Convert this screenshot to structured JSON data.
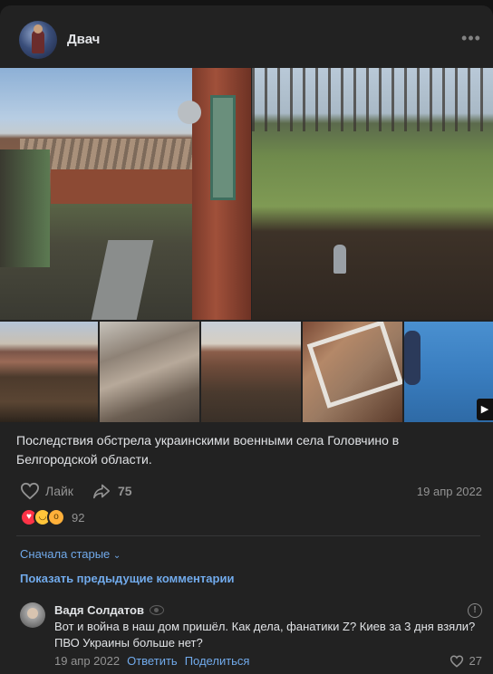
{
  "post": {
    "author": "Двач",
    "more": "•••",
    "text": "Последствия обстрела украинскими военными села Головчино в Белгородской области.",
    "like_label": "Лайк",
    "share_count": "75",
    "date": "19 апр 2022",
    "reactions_count": "92",
    "reaction_icons": [
      "heart-reaction-icon",
      "laugh-reaction-icon",
      "shocked-reaction-icon"
    ],
    "play_glyph": "▶"
  },
  "comments": {
    "sort_label": "Сначала старые",
    "show_previous": "Показать предыдущие комментарии",
    "items": [
      {
        "author": "Вадя Солдатов",
        "text": "Вот и война в наш дом пришёл. Как дела, фанатики Z? Киев за 3 дня взяли? ПВО Украины больше нет?",
        "date": "19 апр 2022",
        "reply_label": "Ответить",
        "share_label": "Поделиться",
        "likes": "27"
      }
    ]
  },
  "colors": {
    "background": "#141414",
    "card": "#222222",
    "link": "#71aaeb",
    "muted": "#939393",
    "text": "#e1e3e6"
  }
}
